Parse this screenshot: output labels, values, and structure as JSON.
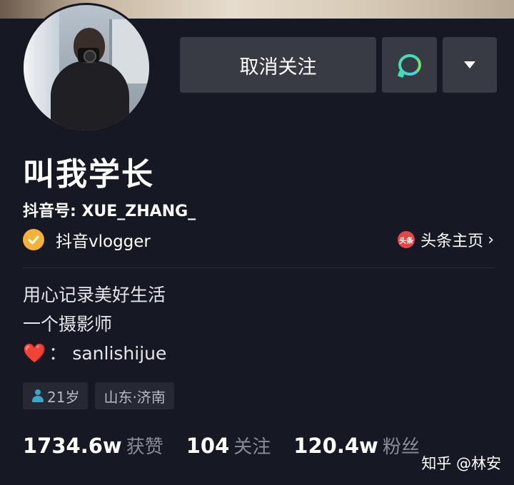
{
  "profile": {
    "name": "叫我学长",
    "douyin_id": "抖音号: XUE_ZHANG_",
    "verified_label": "抖音vlogger",
    "toutiao_icon_text": "头条",
    "toutiao_link": "头条主页",
    "chevron": "›"
  },
  "actions": {
    "unfollow_label": "取消关注"
  },
  "bio": {
    "line1": "用心记录美好生活",
    "line2": "一个摄影师",
    "heart": "❤️",
    "line3": "： sanlishijue"
  },
  "tags": {
    "age": "21岁",
    "location": "山东·济南"
  },
  "stats": {
    "likes_value": "1734.6w",
    "likes_label": "获赞",
    "following_value": "104",
    "following_label": "关注",
    "followers_value": "120.4w",
    "followers_label": "粉丝"
  },
  "watermark": "知乎 @林安",
  "colors": {
    "background": "#161823",
    "button": "#393b44",
    "verified": "#f5b335",
    "message_icon": "#3fe0b5",
    "toutiao": "#e64545"
  }
}
